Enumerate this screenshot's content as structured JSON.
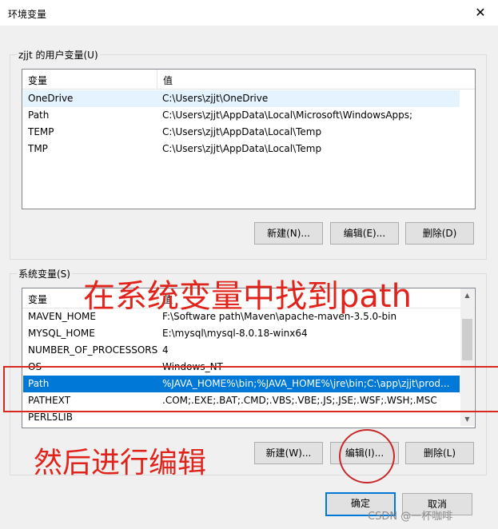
{
  "window": {
    "title": "环境变量",
    "close_icon": "close-icon"
  },
  "user_vars": {
    "group_label": "zjjt 的用户变量(U)",
    "headers": {
      "name": "变量",
      "value": "值"
    },
    "rows": [
      {
        "name": "OneDrive",
        "value": "C:\\Users\\zjjt\\OneDrive"
      },
      {
        "name": "Path",
        "value": "C:\\Users\\zjjt\\AppData\\Local\\Microsoft\\WindowsApps;"
      },
      {
        "name": "TEMP",
        "value": "C:\\Users\\zjjt\\AppData\\Local\\Temp"
      },
      {
        "name": "TMP",
        "value": "C:\\Users\\zjjt\\AppData\\Local\\Temp"
      }
    ],
    "buttons": {
      "new": "新建(N)...",
      "edit": "编辑(E)...",
      "delete": "删除(D)"
    }
  },
  "system_vars": {
    "group_label": "系统变量(S)",
    "headers": {
      "name": "变量",
      "value": "值"
    },
    "rows": [
      {
        "name": "MAVEN_HOME",
        "value": "F:\\Software path\\Maven\\apache-maven-3.5.0-bin"
      },
      {
        "name": "MYSQL_HOME",
        "value": "E:\\mysql\\mysql-8.0.18-winx64"
      },
      {
        "name": "NUMBER_OF_PROCESSORS",
        "value": "4"
      },
      {
        "name": "OS",
        "value": "Windows_NT"
      },
      {
        "name": "Path",
        "value": "%JAVA_HOME%\\bin;%JAVA_HOME%\\jre\\bin;C:\\app\\zjjt\\prod..."
      },
      {
        "name": "PATHEXT",
        "value": ".COM;.EXE;.BAT;.CMD;.VBS;.VBE;.JS;.JSE;.WSF;.WSH;.MSC"
      },
      {
        "name": "PERL5LIB",
        "value": ""
      }
    ],
    "selected_row": "Path",
    "buttons": {
      "new": "新建(W)...",
      "edit": "编辑(I)...",
      "delete": "删除(L)"
    }
  },
  "dialog_buttons": {
    "ok": "确定",
    "cancel": "取消"
  },
  "annotations": {
    "find_path": "在系统变量中找到path",
    "then_edit": "然后进行编辑",
    "color": "#e0241b"
  },
  "watermark": "CSDN @一杯咖啡",
  "colors": {
    "selection": "#0078d7",
    "accent_border": "#0078d7"
  }
}
